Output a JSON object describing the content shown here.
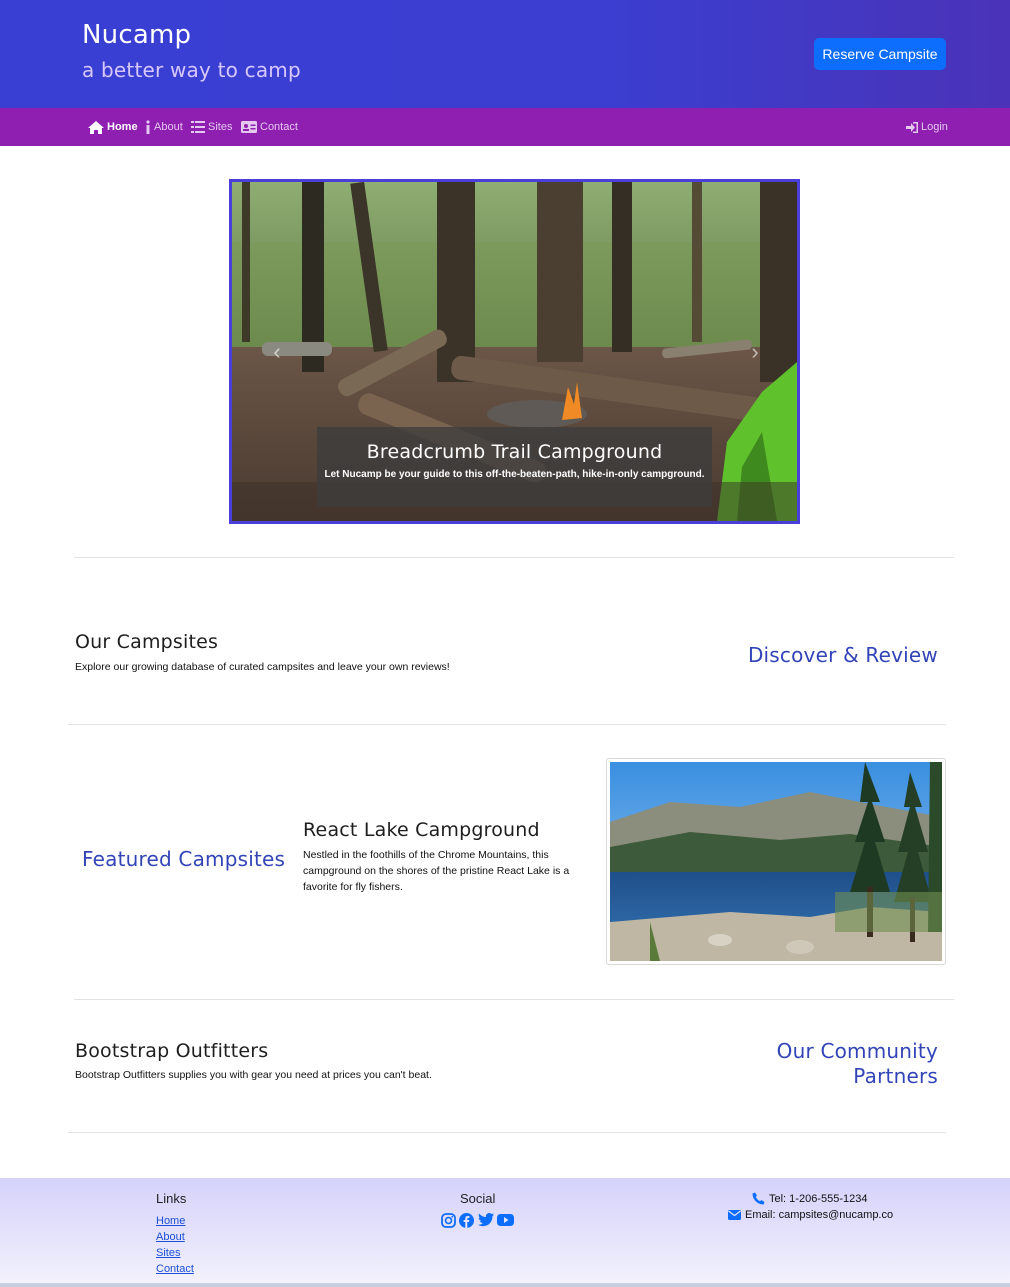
{
  "header": {
    "title": "Nucamp",
    "subtitle": "a better way to camp",
    "reserve_label": "Reserve Campsite"
  },
  "nav": {
    "items": [
      {
        "label": "Home",
        "icon": "home-icon",
        "active": true
      },
      {
        "label": "About",
        "icon": "info-icon",
        "active": false
      },
      {
        "label": "Sites",
        "icon": "list-icon",
        "active": false
      },
      {
        "label": "Contact",
        "icon": "address-card-icon",
        "active": false
      }
    ],
    "login_label": "Login"
  },
  "carousel": {
    "caption_title": "Breadcrumb Trail Campground",
    "caption_text": "Let Nucamp be your guide to this off-the-beaten-path, hike-in-only campground.",
    "prev_glyph": "‹",
    "next_glyph": "›"
  },
  "campsites": {
    "heading": "Our Campsites",
    "text": "Explore our growing database of curated campsites and leave your own reviews!",
    "label": "Discover & Review"
  },
  "featured": {
    "label": "Featured Campsites",
    "heading": "React Lake Campground",
    "text": "Nestled in the foothills of the Chrome Mountains, this campground on the shores of the pristine React Lake is a favorite for fly fishers."
  },
  "partners": {
    "heading": "Bootstrap Outfitters",
    "text": "Bootstrap Outfitters supplies you with gear you need at prices you can't beat.",
    "label_line1": "Our Community",
    "label_line2": "Partners"
  },
  "footer": {
    "links_heading": "Links",
    "links": [
      "Home",
      "About",
      "Sites",
      "Contact"
    ],
    "social_heading": "Social",
    "social_icons": [
      "instagram-icon",
      "facebook-icon",
      "twitter-icon",
      "youtube-icon"
    ],
    "tel": "Tel: 1-206-555-1234",
    "email": "Email: campsites@nucamp.co"
  },
  "colors": {
    "header_gradient_start": "#3a3fd4",
    "nav_bg": "#8e1fb1",
    "accent_blue": "#0d6efd",
    "section_label": "#3244b8",
    "carousel_border": "#4a3fd8"
  }
}
